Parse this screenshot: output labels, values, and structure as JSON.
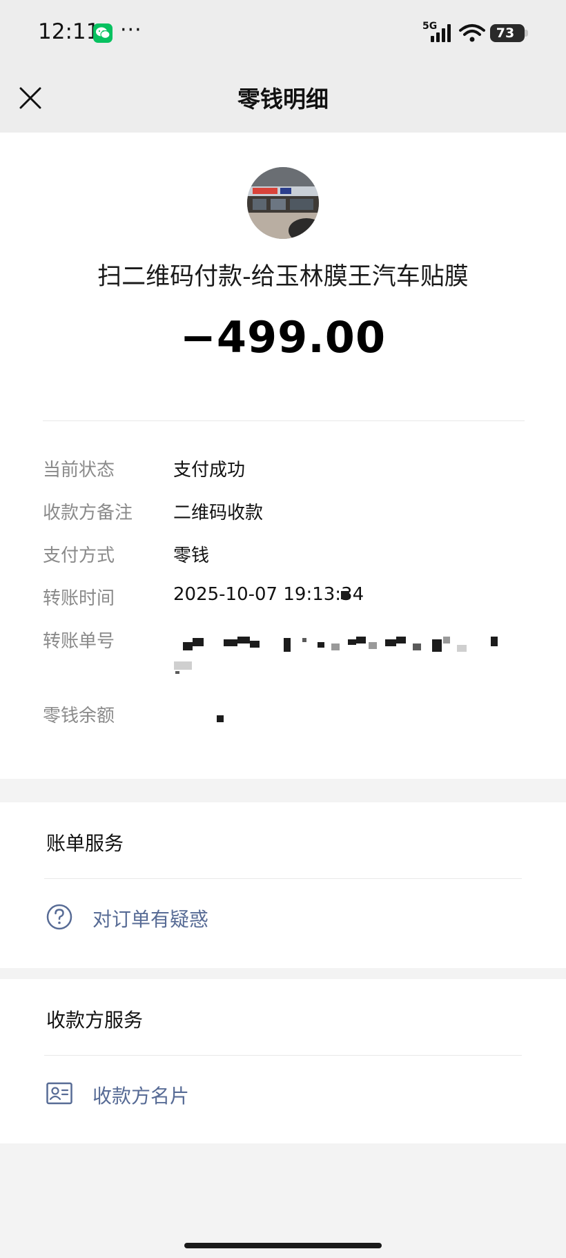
{
  "status_bar": {
    "time": "12:11",
    "more": "···",
    "network": "5G",
    "battery": "73",
    "icons": [
      "wechat-icon",
      "signal-icon",
      "wifi-icon",
      "battery-icon"
    ]
  },
  "nav": {
    "title": "零钱明细",
    "close_icon": "close-icon"
  },
  "summary": {
    "payee_title": "扫二维码付款-给玉林膜王汽车贴膜",
    "amount": "−499.00",
    "avatar_icon": "store-photo-avatar"
  },
  "details": [
    {
      "label": "当前状态",
      "value": "支付成功"
    },
    {
      "label": "收款方备注",
      "value": "二维码收款"
    },
    {
      "label": "支付方式",
      "value": "零钱"
    },
    {
      "label": "转账时间",
      "value": "2025-10-07 19:13:34"
    },
    {
      "label": "转账单号",
      "value": ""
    },
    {
      "label": "零钱余额",
      "value": ""
    }
  ],
  "bill_service": {
    "heading": "账单服务",
    "link_label": "对订单有疑惑",
    "link_icon": "question-circle-icon"
  },
  "payee_service": {
    "heading": "收款方服务",
    "link_label": "收款方名片",
    "link_icon": "business-card-icon"
  },
  "colors": {
    "page_bg": "#f3f3f3",
    "header_bg": "#ededed",
    "link": "#576b95",
    "label": "#8a8a8a"
  }
}
